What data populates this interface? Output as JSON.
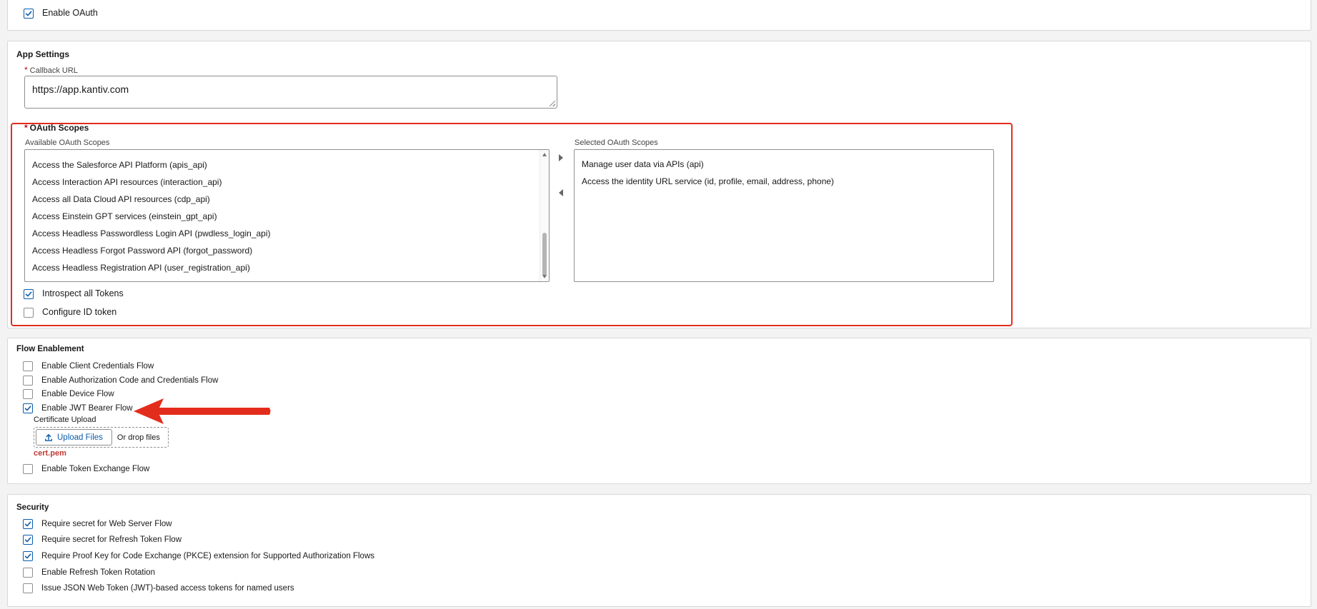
{
  "oauth": {
    "enable_label": "Enable OAuth",
    "enable_checked": true
  },
  "app_settings": {
    "title": "App Settings",
    "callback_label": "Callback URL",
    "callback_value": "https://app.kantiv.com",
    "required_mark": "*"
  },
  "scopes": {
    "title": "OAuth Scopes",
    "available_label": "Available OAuth Scopes",
    "selected_label": "Selected OAuth Scopes",
    "available": [
      "Access the Salesforce API Platform (apis_api)",
      "Access Interaction API resources (interaction_api)",
      "Access all Data Cloud API resources (cdp_api)",
      "Access Einstein GPT services (einstein_gpt_api)",
      "Access Headless Passwordless Login API (pwdless_login_api)",
      "Access Headless Forgot Password API (forgot_password)",
      "Access Headless Registration API (user_registration_api)"
    ],
    "selected": [
      "Manage user data via APIs (api)",
      "Access the identity URL service (id, profile, email, address, phone)"
    ],
    "introspect_label": "Introspect all Tokens",
    "introspect_checked": true,
    "id_token_label": "Configure ID token",
    "id_token_checked": false
  },
  "flow": {
    "title": "Flow Enablement",
    "client_credentials_label": "Enable Client Credentials Flow",
    "auth_code_label": "Enable Authorization Code and Credentials Flow",
    "device_flow_label": "Enable Device Flow",
    "jwt_label": "Enable JWT Bearer Flow",
    "jwt_checked": true,
    "certificate_label": "Certificate Upload",
    "upload_button": "Upload Files",
    "drop_text": "Or drop files",
    "file_name": "cert.pem",
    "token_exchange_label": "Enable Token Exchange Flow"
  },
  "security": {
    "title": "Security",
    "items": [
      {
        "label": "Require secret for Web Server Flow",
        "checked": true
      },
      {
        "label": "Require secret for Refresh Token Flow",
        "checked": true
      },
      {
        "label": "Require Proof Key for Code Exchange (PKCE) extension for Supported Authorization Flows",
        "checked": true
      },
      {
        "label": "Enable Refresh Token Rotation",
        "checked": false
      },
      {
        "label": "Issue JSON Web Token (JWT)-based access tokens for named users",
        "checked": false
      }
    ]
  },
  "colors": {
    "accent": "#0b5cab",
    "annotation": "#e32d1c",
    "file_name": "#c23934"
  }
}
